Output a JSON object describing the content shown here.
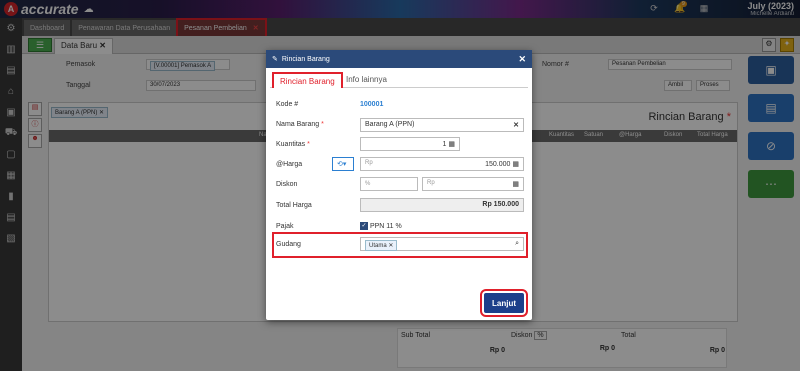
{
  "app": {
    "logo_text": "accurate",
    "period": "July (2023)",
    "user": "Michelle Ardianti",
    "notif_count": "9"
  },
  "tabs": [
    {
      "label": "Dashboard"
    },
    {
      "label": "Penawaran Data Perusahaan"
    },
    {
      "label": "Pesanan Pembelian"
    }
  ],
  "subtab": {
    "label": "Data Baru"
  },
  "form": {
    "pemasok_label": "Pemasok",
    "pemasok_value": "[V.00001] Pemasok A",
    "tanggal_label": "Tanggal",
    "tanggal_value": "30/07/2023",
    "nomor_label": "Nomor #",
    "tipe_value": "Pesanan Pembelian",
    "ambil_label": "Ambil",
    "proses_label": "Proses"
  },
  "grid": {
    "title": "Rincian Barang",
    "filter_chip": "Barang A (PPN)",
    "cols": [
      "Nama Barang",
      "Kuantitas",
      "Satuan",
      "@Harga",
      "Diskon",
      "Total Harga"
    ]
  },
  "totals": {
    "subtotal_label": "Sub Total",
    "subtotal_value": "Rp 0",
    "diskon_label": "Diskon",
    "diskon_unit": "%",
    "diskon_value": "Rp 0",
    "total_label": "Total",
    "total_value": "Rp 0"
  },
  "modal": {
    "title": "Rincian Barang",
    "tab_active": "Rincian Barang",
    "tab_other": "Info lainnya",
    "kode_label": "Kode #",
    "kode_value": "100001",
    "nama_label": "Nama Barang",
    "nama_value": "Barang A (PPN)",
    "kuantitas_label": "Kuantitas",
    "kuantitas_value": "1",
    "harga_label": "@Harga",
    "harga_prefix": "Rp",
    "harga_value": "150.000",
    "diskon_label": "Diskon",
    "diskon_pct_prefix": "%",
    "diskon_rp_prefix": "Rp",
    "total_label": "Total Harga",
    "total_value": "Rp 150.000",
    "pajak_label": "Pajak",
    "pajak_value": "PPN 11 %",
    "gudang_label": "Gudang",
    "gudang_chip": "Utama",
    "lanjut_label": "Lanjut"
  },
  "colors": {
    "accent": "#e0202b",
    "primary": "#2b4a7a",
    "button": "#1d3f8a"
  }
}
